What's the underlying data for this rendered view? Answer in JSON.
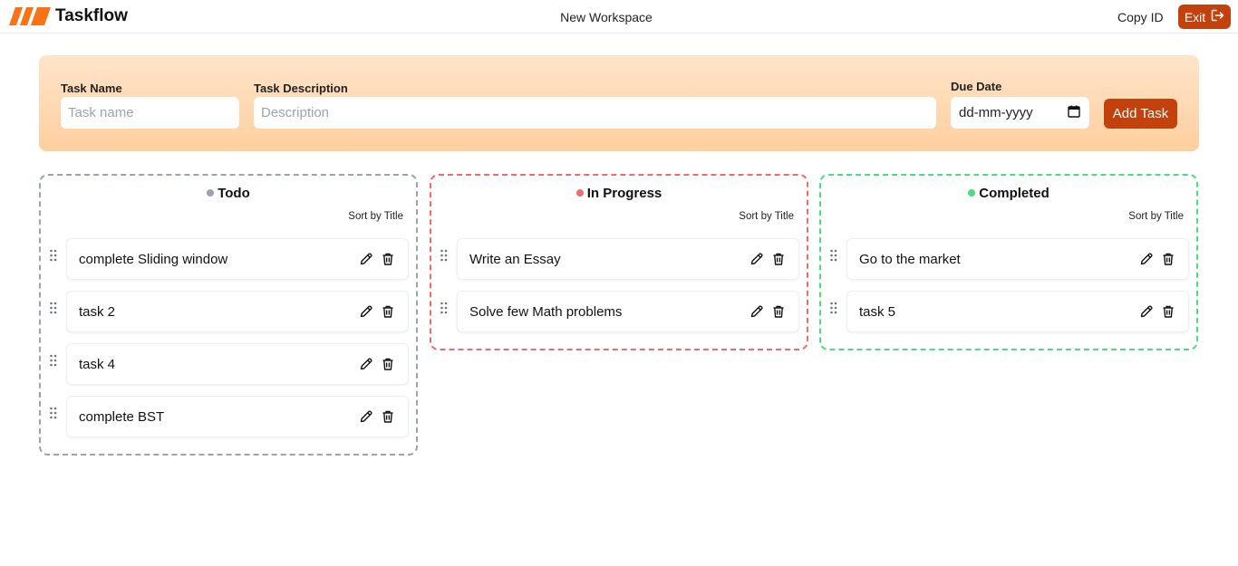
{
  "app": {
    "brand": "Taskflow",
    "workspace_name": "New Workspace",
    "copy_id_label": "Copy ID",
    "exit_label": "Exit"
  },
  "colors": {
    "accent": "#c2410c",
    "logo": "#f97316",
    "todo": "#9ca3af",
    "in_progress": "#f06b6b",
    "completed": "#4ade80"
  },
  "form": {
    "task_name_label": "Task Name",
    "task_name_placeholder": "Task name",
    "task_desc_label": "Task Description",
    "task_desc_placeholder": "Description",
    "due_date_label": "Due Date",
    "due_date_value": "dd-mm-yyyy",
    "due_date_icon": "calendar-icon",
    "add_task_label": "Add Task"
  },
  "columns": [
    {
      "title": "Todo",
      "sort_label": "Sort by Title",
      "tasks": [
        {
          "title": "complete Sliding window"
        },
        {
          "title": "task 2"
        },
        {
          "title": "task 4"
        },
        {
          "title": "complete BST"
        }
      ]
    },
    {
      "title": "In Progress",
      "sort_label": "Sort by Title",
      "tasks": [
        {
          "title": "Write an Essay"
        },
        {
          "title": "Solve few Math problems"
        }
      ]
    },
    {
      "title": "Completed",
      "sort_label": "Sort by Title",
      "tasks": [
        {
          "title": "Go to the market"
        },
        {
          "title": "task 5"
        }
      ]
    }
  ],
  "icons": {
    "drag": "drag-handle-icon",
    "edit": "pencil-icon",
    "delete": "trash-icon",
    "exit": "logout-icon"
  }
}
